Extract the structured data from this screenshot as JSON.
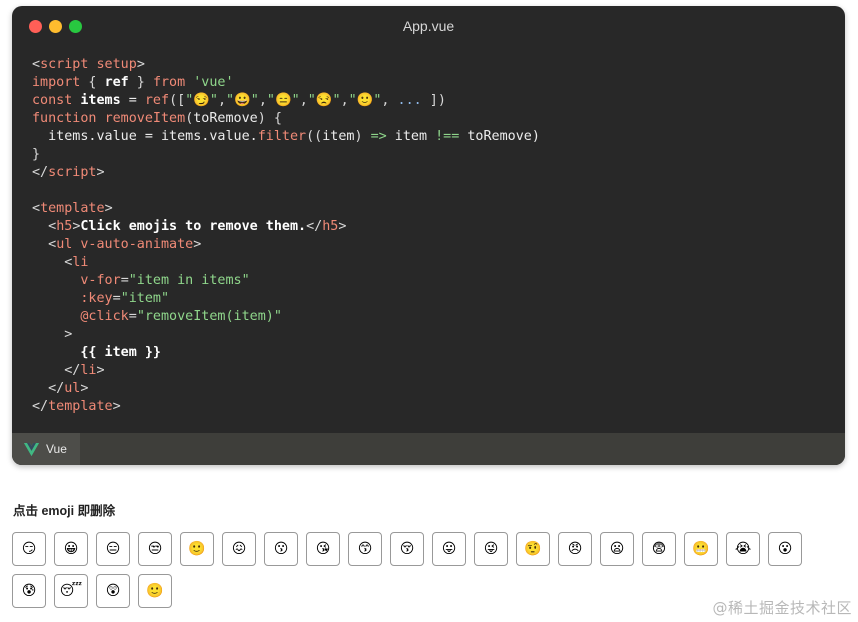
{
  "window": {
    "title": "App.vue",
    "tab_label": "Vue"
  },
  "code_lines": [
    [
      [
        "<",
        "punct"
      ],
      [
        "script setup",
        "tag"
      ],
      [
        ">",
        "punct"
      ]
    ],
    [
      [
        "import",
        "kw"
      ],
      [
        " { ",
        "punct"
      ],
      [
        "ref",
        "var"
      ],
      [
        " } ",
        "punct"
      ],
      [
        "from",
        "kw"
      ],
      [
        " ",
        "plain"
      ],
      [
        "'vue'",
        "str"
      ]
    ],
    [
      [
        "const",
        "kw"
      ],
      [
        " ",
        "plain"
      ],
      [
        "items",
        "var"
      ],
      [
        " = ",
        "plain"
      ],
      [
        "ref",
        "fn"
      ],
      [
        "([",
        "punct"
      ],
      [
        "\"😏\"",
        "str"
      ],
      [
        ",",
        "punct"
      ],
      [
        "\"😀\"",
        "str"
      ],
      [
        ",",
        "punct"
      ],
      [
        "\"😑\"",
        "str"
      ],
      [
        ",",
        "punct"
      ],
      [
        "\"😒\"",
        "str"
      ],
      [
        ",",
        "punct"
      ],
      [
        "\"🙂\"",
        "str"
      ],
      [
        ", ",
        "punct"
      ],
      [
        "...",
        "dots"
      ],
      [
        " ])",
        "punct"
      ]
    ],
    [
      [
        "function",
        "kw"
      ],
      [
        " ",
        "plain"
      ],
      [
        "removeItem",
        "fn"
      ],
      [
        "(",
        "punct"
      ],
      [
        "toRemove",
        "plain"
      ],
      [
        ") {",
        "punct"
      ]
    ],
    [
      [
        "  items.value = items.value.",
        "plain"
      ],
      [
        "filter",
        "fn"
      ],
      [
        "((",
        "punct"
      ],
      [
        "item",
        "plain"
      ],
      [
        ") ",
        "punct"
      ],
      [
        "=>",
        "op"
      ],
      [
        " item ",
        "plain"
      ],
      [
        "!==",
        "op"
      ],
      [
        " toRemove)",
        "plain"
      ]
    ],
    [
      [
        "}",
        "punct"
      ]
    ],
    [
      [
        "</",
        "punct"
      ],
      [
        "script",
        "tag"
      ],
      [
        ">",
        "punct"
      ]
    ],
    [],
    [
      [
        "<",
        "punct"
      ],
      [
        "template",
        "tag"
      ],
      [
        ">",
        "punct"
      ]
    ],
    [
      [
        "  <",
        "punct"
      ],
      [
        "h5",
        "tag"
      ],
      [
        ">",
        "punct"
      ],
      [
        "Click emojis to remove them.",
        "var"
      ],
      [
        "</",
        "punct"
      ],
      [
        "h5",
        "tag"
      ],
      [
        ">",
        "punct"
      ]
    ],
    [
      [
        "  <",
        "punct"
      ],
      [
        "ul v-auto-animate",
        "tag"
      ],
      [
        ">",
        "punct"
      ]
    ],
    [
      [
        "    <",
        "punct"
      ],
      [
        "li",
        "tag"
      ]
    ],
    [
      [
        "      ",
        "plain"
      ],
      [
        "v-for",
        "attr"
      ],
      [
        "=",
        "punct"
      ],
      [
        "\"item in items\"",
        "str"
      ]
    ],
    [
      [
        "      ",
        "plain"
      ],
      [
        ":key",
        "attr"
      ],
      [
        "=",
        "punct"
      ],
      [
        "\"item\"",
        "str"
      ]
    ],
    [
      [
        "      ",
        "plain"
      ],
      [
        "@click",
        "attr"
      ],
      [
        "=",
        "punct"
      ],
      [
        "\"removeItem(item)\"",
        "str"
      ]
    ],
    [
      [
        "    >",
        "punct"
      ]
    ],
    [
      [
        "      ",
        "plain"
      ],
      [
        "{{ item }}",
        "var"
      ]
    ],
    [
      [
        "    </",
        "punct"
      ],
      [
        "li",
        "tag"
      ],
      [
        ">",
        "punct"
      ]
    ],
    [
      [
        "  </",
        "punct"
      ],
      [
        "ul",
        "tag"
      ],
      [
        ">",
        "punct"
      ]
    ],
    [
      [
        "</",
        "punct"
      ],
      [
        "template",
        "tag"
      ],
      [
        ">",
        "punct"
      ]
    ]
  ],
  "demo": {
    "heading": "点击 emoji 即删除",
    "emojis": [
      "😏",
      "😀",
      "😑",
      "😒",
      "🙂",
      "😖",
      "😗",
      "😘",
      "😙",
      "😚",
      "😛",
      "😜",
      "🤨",
      "😠",
      "😦",
      "😨",
      "😬",
      "😭",
      "😮",
      "😰",
      "😴",
      "😲",
      "🙂"
    ]
  },
  "watermark": "@稀土掘金技术社区",
  "colors": {
    "editor_bg": "#282828",
    "tag": "#f08a77",
    "string": "#8fd68b",
    "vue_green": "#42b883"
  }
}
